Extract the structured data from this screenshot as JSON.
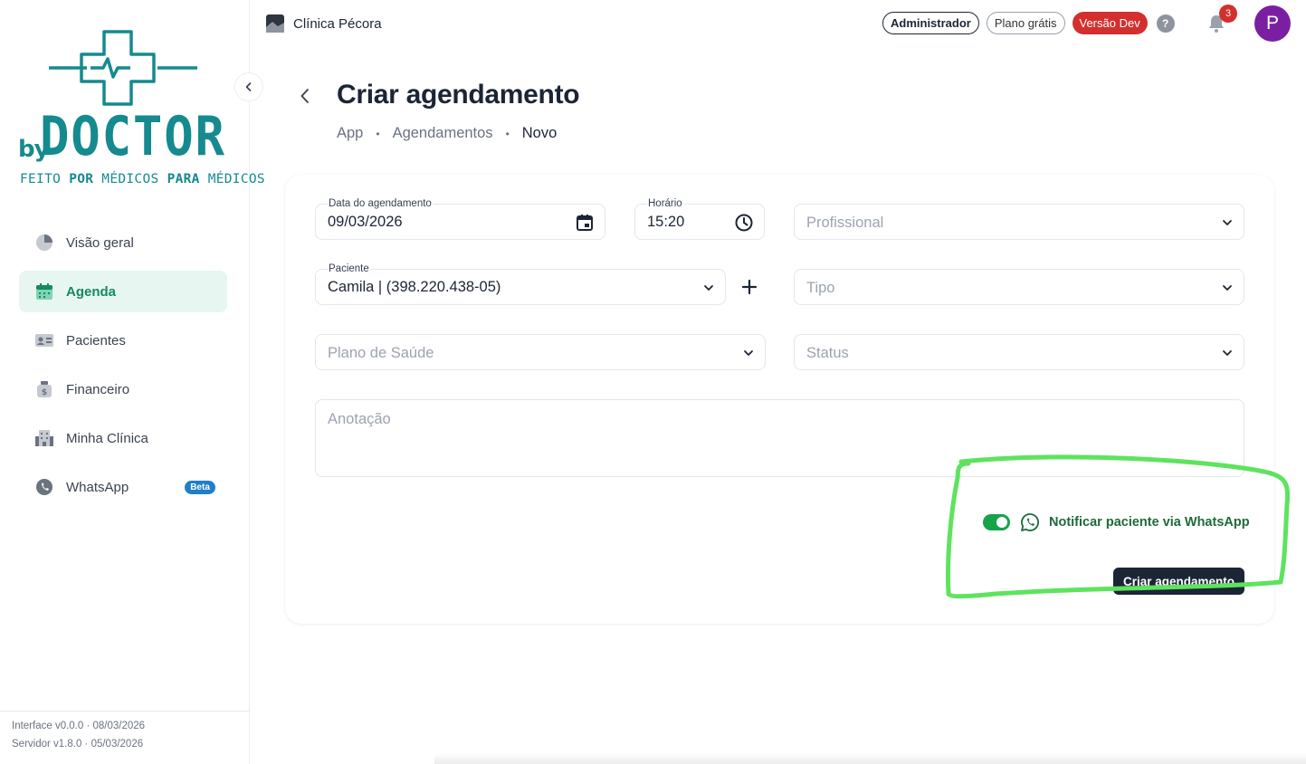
{
  "clinic": {
    "name": "Clínica Pécora"
  },
  "header": {
    "admin_label": "Administrador",
    "plan_label": "Plano grátis",
    "dev_label": "Versão Dev",
    "help_label": "?",
    "notifications_count": "3",
    "avatar_initial": "P"
  },
  "logo": {
    "by": "by",
    "name": "DOCTOR",
    "tagline_a": "FEITO ",
    "tagline_b": "POR",
    "tagline_c": " MÉDICOS ",
    "tagline_d": "PARA",
    "tagline_e": " MÉDICOS"
  },
  "sidebar": {
    "items": [
      {
        "label": "Visão geral",
        "icon": "pie-chart-icon"
      },
      {
        "label": "Agenda",
        "icon": "calendar-icon"
      },
      {
        "label": "Pacientes",
        "icon": "id-card-icon"
      },
      {
        "label": "Financeiro",
        "icon": "money-bag-icon"
      },
      {
        "label": "Minha Clínica",
        "icon": "building-icon"
      },
      {
        "label": "WhatsApp",
        "icon": "whatsapp-icon",
        "badge": "Beta"
      }
    ],
    "footer": {
      "interface": "Interface v0.0.0 · 08/03/2026",
      "server": "Servidor v1.8.0 · 05/03/2026"
    }
  },
  "page": {
    "title": "Criar agendamento",
    "breadcrumb": [
      "App",
      "Agendamentos",
      "Novo"
    ]
  },
  "form": {
    "date": {
      "label": "Data do agendamento",
      "value": "09/03/2026"
    },
    "time": {
      "label": "Horário",
      "value": "15:20"
    },
    "professional": {
      "placeholder": "Profissional"
    },
    "patient": {
      "label": "Paciente",
      "value": "Camila | (398.220.438-05)"
    },
    "type": {
      "placeholder": "Tipo"
    },
    "health_plan": {
      "placeholder": "Plano de Saúde"
    },
    "status": {
      "placeholder": "Status"
    },
    "notes": {
      "placeholder": "Anotação"
    },
    "notify": {
      "label": "Notificar paciente via WhatsApp",
      "enabled": true
    },
    "submit_label": "Criar agendamento"
  },
  "colors": {
    "brand": "#158a8f",
    "active_nav": "#138a61",
    "toggle_on": "#16a34a",
    "highlight_annotation": "#5ee35e"
  }
}
